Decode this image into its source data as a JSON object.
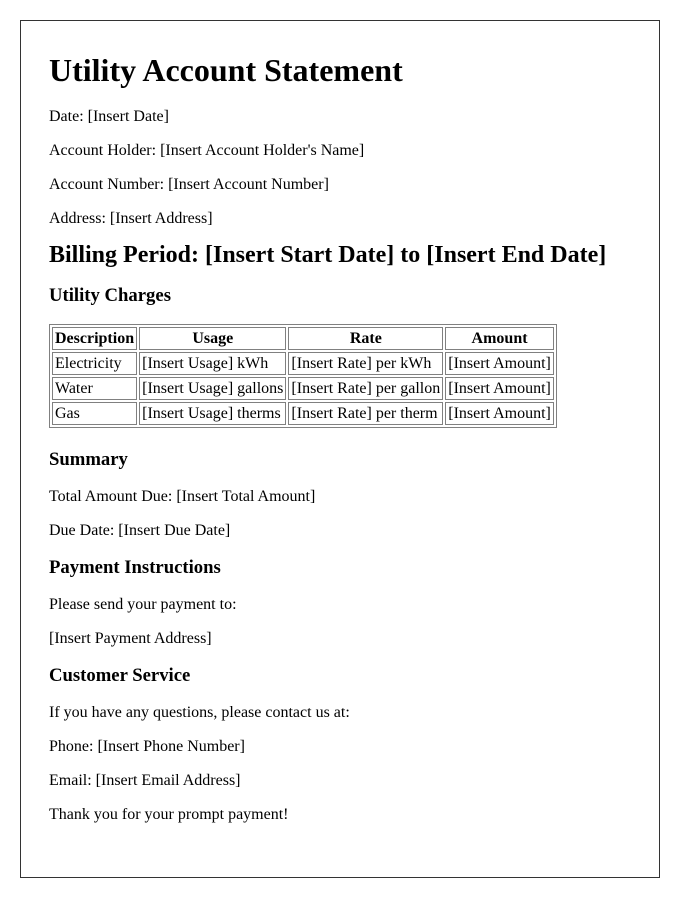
{
  "document": {
    "title": "Utility Account Statement",
    "info": [
      "Date: [Insert Date]",
      "Account Holder: [Insert Account Holder's Name]",
      "Account Number: [Insert Account Number]",
      "Address: [Insert Address]"
    ],
    "billing_period": "Billing Period: [Insert Start Date] to [Insert End Date]",
    "charges": {
      "heading": "Utility Charges",
      "columns": [
        "Description",
        "Usage",
        "Rate",
        "Amount"
      ],
      "rows": [
        [
          "Electricity",
          "[Insert Usage] kWh",
          "[Insert Rate] per kWh",
          "[Insert Amount]"
        ],
        [
          "Water",
          "[Insert Usage] gallons",
          "[Insert Rate] per gallon",
          "[Insert Amount]"
        ],
        [
          "Gas",
          "[Insert Usage] therms",
          "[Insert Rate] per therm",
          "[Insert Amount]"
        ]
      ]
    },
    "summary": {
      "heading": "Summary",
      "lines": [
        "Total Amount Due: [Insert Total Amount]",
        "Due Date: [Insert Due Date]"
      ]
    },
    "payment": {
      "heading": "Payment Instructions",
      "lines": [
        "Please send your payment to:",
        "[Insert Payment Address]"
      ]
    },
    "customer_service": {
      "heading": "Customer Service",
      "lines": [
        "If you have any questions, please contact us at:",
        "Phone: [Insert Phone Number]",
        "Email: [Insert Email Address]",
        "Thank you for your prompt payment!"
      ]
    }
  }
}
